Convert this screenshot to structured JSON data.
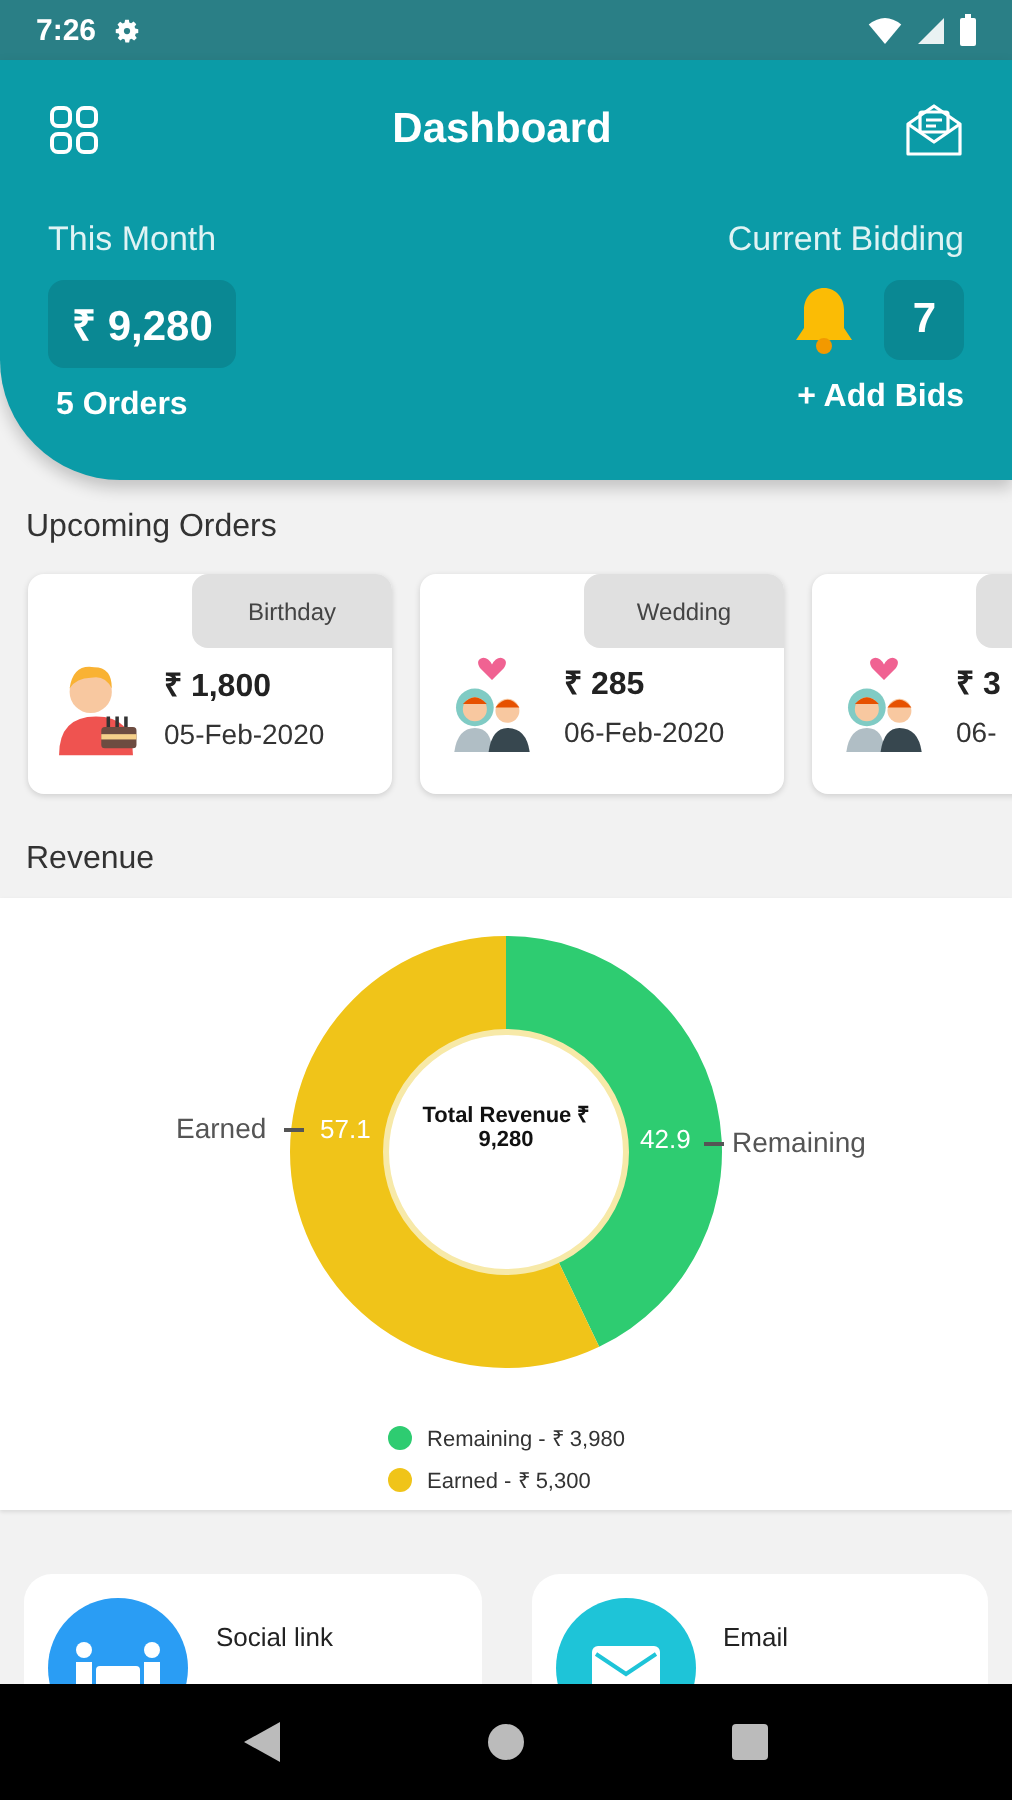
{
  "status_bar": {
    "time": "7:26"
  },
  "header": {
    "title": "Dashboard",
    "this_month": {
      "label": "This Month",
      "amount": "₹ 9,280",
      "orders": "5 Orders"
    },
    "bidding": {
      "label": "Current Bidding",
      "count": "7",
      "action": "+ Add Bids"
    }
  },
  "upcoming": {
    "title": "Upcoming Orders",
    "orders": [
      {
        "kind": "birthday",
        "tag": "Birthday",
        "amount": "₹ 1,800",
        "date": "05-Feb-2020"
      },
      {
        "kind": "wedding",
        "tag": "Wedding",
        "amount": "₹ 285",
        "date": "06-Feb-2020"
      },
      {
        "kind": "wedding",
        "amount": "₹ 3",
        "date": "06-"
      }
    ]
  },
  "revenue": {
    "title": "Revenue",
    "center": "Total Revenue ₹ 9,280",
    "chart_data": {
      "type": "donut",
      "categories": [
        "Remaining",
        "Earned"
      ],
      "values": [
        42.9,
        57.1
      ],
      "data_labels": true
    },
    "legend": [
      {
        "label": "Remaining - ₹ 3,980",
        "color": "#2ecc71"
      },
      {
        "label": "Earned - ₹ 5,300",
        "color": "#f0c419"
      }
    ]
  },
  "shortcuts": [
    {
      "kind": "social",
      "label": "Social link"
    },
    {
      "kind": "email",
      "label": "Email"
    }
  ]
}
